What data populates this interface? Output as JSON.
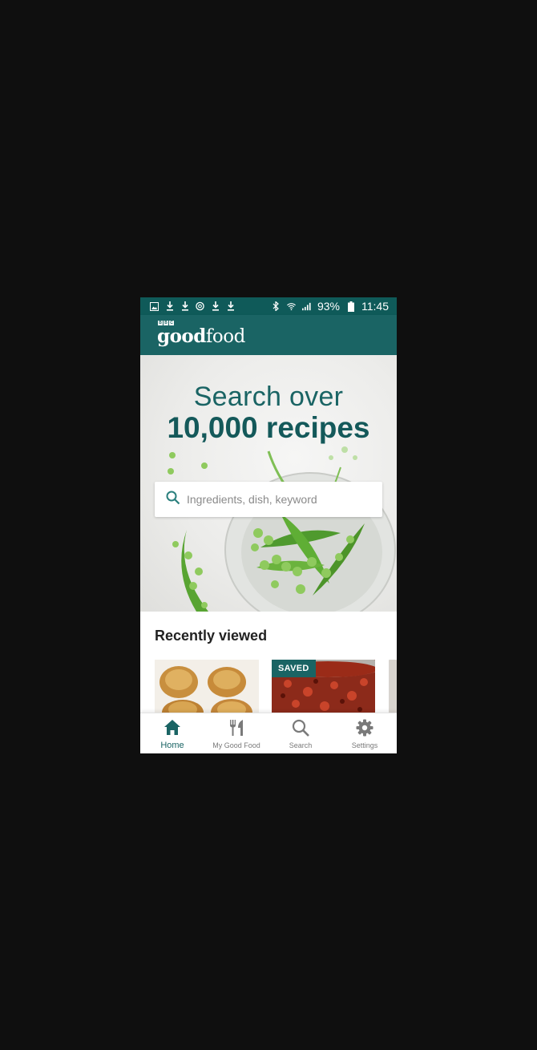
{
  "status_bar": {
    "left_icons": [
      "image-icon",
      "download-icon",
      "download-icon",
      "sync-icon",
      "download-icon",
      "download-icon"
    ],
    "right_icons": [
      "bluetooth-icon",
      "wifi-icon",
      "signal-icon"
    ],
    "battery": "93%",
    "time": "11:45"
  },
  "app_bar": {
    "logo_badge": [
      "B",
      "B",
      "C"
    ],
    "logo_part_1": "good",
    "logo_part_2": "food",
    "color": "#1a6464"
  },
  "hero": {
    "title_line_1": "Search over",
    "title_line_2": "10,000 recipes",
    "search_placeholder": "Ingredients, dish, keyword"
  },
  "recently_viewed": {
    "title": "Recently viewed",
    "cards": [
      {
        "image": "yorkshire-puddings",
        "badge": ""
      },
      {
        "image": "chilli-pot",
        "badge": "SAVED"
      },
      {
        "image": "partial-card",
        "badge": ""
      }
    ]
  },
  "bottom_nav": {
    "items": [
      {
        "label": "Home",
        "icon": "home-icon",
        "active": true
      },
      {
        "label": "My Good Food",
        "icon": "cutlery-icon",
        "active": false
      },
      {
        "label": "Search",
        "icon": "search-icon",
        "active": false
      },
      {
        "label": "Settings",
        "icon": "gear-icon",
        "active": false
      }
    ]
  },
  "colors": {
    "brand": "#1a6464",
    "status_bar": "#0f5a59",
    "background": "#0f0f0f"
  }
}
